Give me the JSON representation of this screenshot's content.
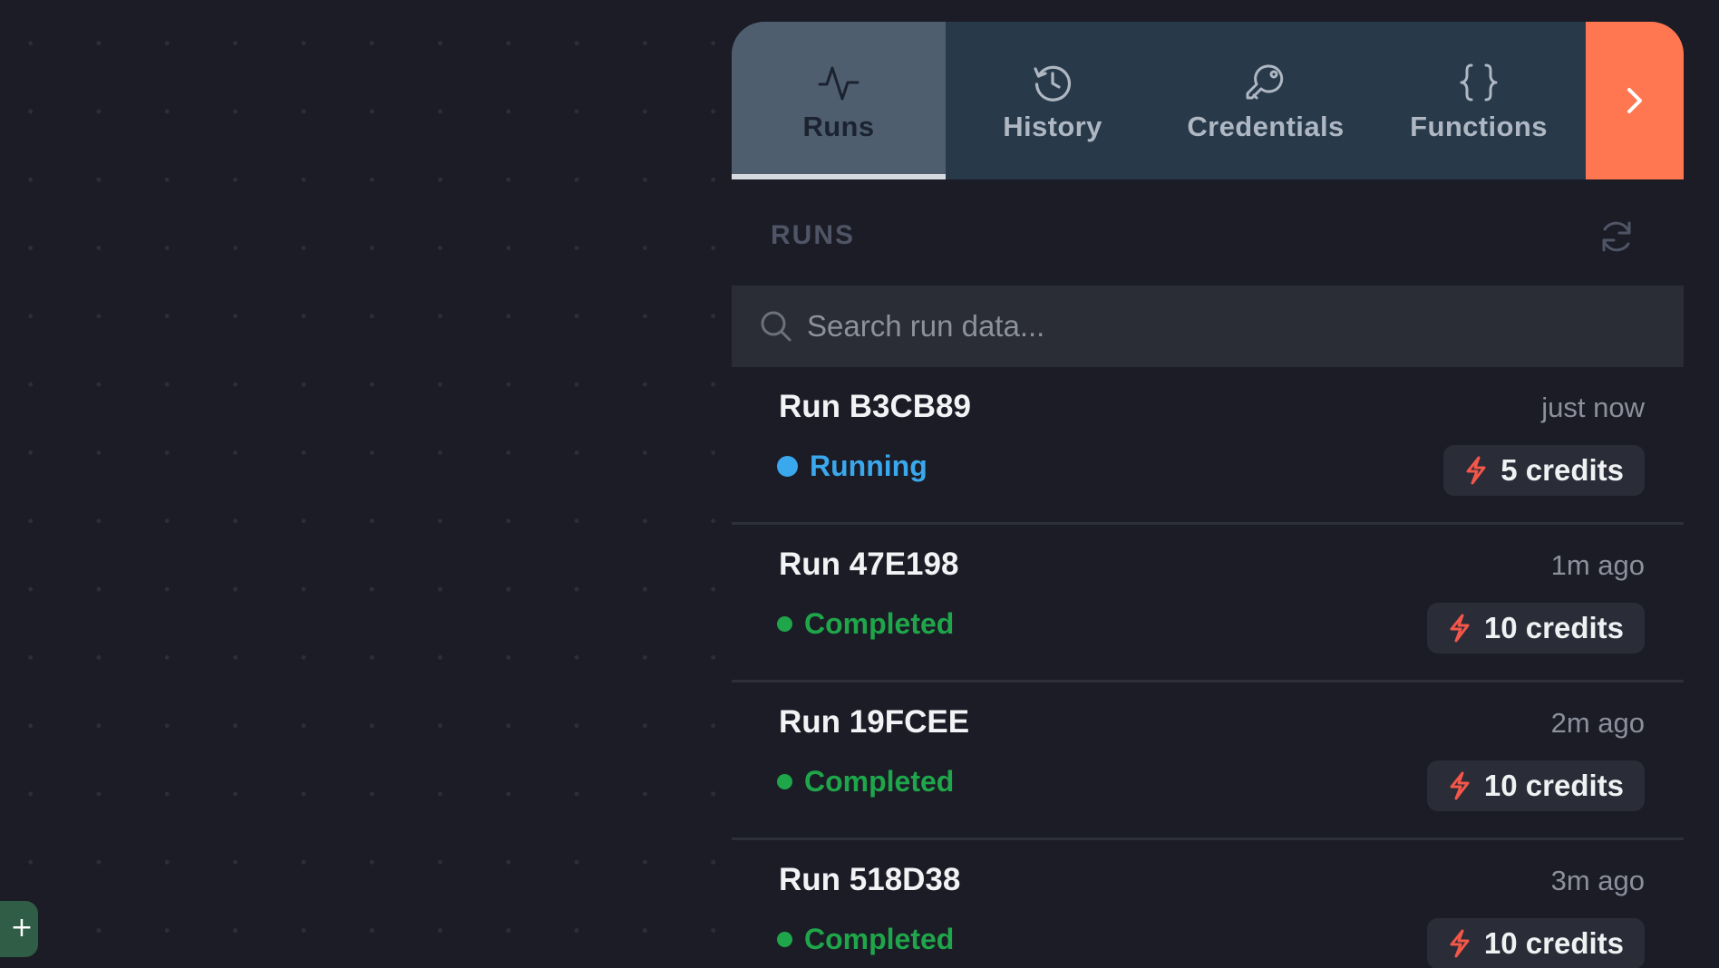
{
  "canvas": {
    "add_button_label": "+"
  },
  "tabs": [
    {
      "label": "Runs",
      "icon": "activity-icon",
      "active": true
    },
    {
      "label": "History",
      "icon": "history-icon",
      "active": false
    },
    {
      "label": "Credentials",
      "icon": "key-icon",
      "active": false
    },
    {
      "label": "Functions",
      "icon": "braces-icon",
      "active": false
    }
  ],
  "expand_button": {
    "icon": "chevron-right-icon"
  },
  "runs_panel": {
    "header": "RUNS",
    "refresh_icon": "refresh-icon",
    "search": {
      "placeholder": "Search run data...",
      "value": ""
    },
    "runs": [
      {
        "name": "Run B3CB89",
        "time": "just now",
        "status": "Running",
        "credits": "5 credits"
      },
      {
        "name": "Run 47E198",
        "time": "1m ago",
        "status": "Completed",
        "credits": "10 credits"
      },
      {
        "name": "Run 19FCEE",
        "time": "2m ago",
        "status": "Completed",
        "credits": "10 credits"
      },
      {
        "name": "Run 518D38",
        "time": "3m ago",
        "status": "Completed",
        "credits": "10 credits"
      }
    ]
  },
  "colors": {
    "background": "#1b1c26",
    "tabbar": "#28394a",
    "tab_active": "#4f5e6e",
    "accent_orange": "#ff7750",
    "running": "#3aa8ec",
    "completed": "#1fa64a",
    "bolt": "#f4574a"
  }
}
